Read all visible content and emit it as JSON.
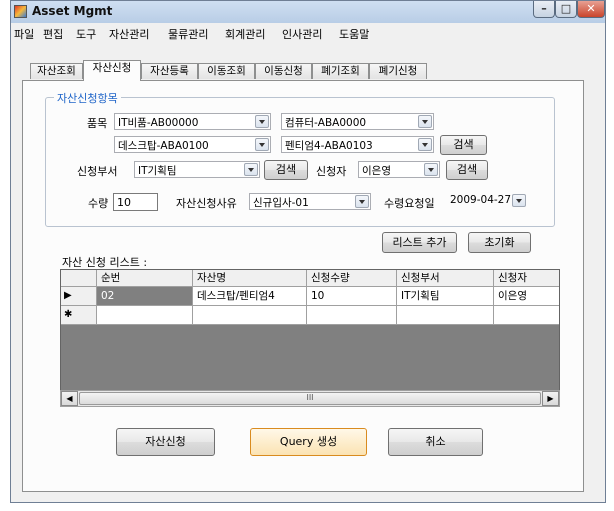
{
  "window": {
    "title": "Asset Mgmt"
  },
  "menu": [
    "파일",
    "편집",
    "도구",
    "자산관리",
    "물류관리",
    "회계관리",
    "인사관리",
    "도움말"
  ],
  "tabs": [
    "자산조회",
    "자산신청",
    "자산등록",
    "이동조회",
    "이동신청",
    "폐기조회",
    "폐기신청"
  ],
  "active_tab": "자산신청",
  "form": {
    "group_title": "자산신청항목",
    "item_label": "품목",
    "item_combo1": "IT비품-AB00000",
    "item_combo2": "컴퓨터-ABA0000",
    "item_combo3": "데스크탑-ABA0100",
    "item_combo4": "펜티엄4-ABA0103",
    "search_label": "검색",
    "dept_label": "신청부서",
    "dept_value": "IT기획팀",
    "requester_label": "신청자",
    "requester_value": "이은영",
    "qty_label": "수량",
    "qty_value": "10",
    "reason_label": "자산신청사유",
    "reason_value": "신규입사-01",
    "date_label": "수령요청일",
    "date_value": "2009-04-27",
    "add_list_button": "리스트 추가",
    "reset_button": "초기화"
  },
  "list": {
    "title": "자산 신청 리스트 :",
    "columns": [
      "순번",
      "자산명",
      "신청수량",
      "신청부서",
      "신청자"
    ],
    "rows": [
      {
        "marker": "▶",
        "cells": [
          "02",
          "데스크탑/펜티엄4",
          "10",
          "IT기획팀",
          "이은영"
        ]
      }
    ],
    "new_row_marker": "✱",
    "scroll_thumb": "III"
  },
  "buttons": {
    "apply": "자산신청",
    "query": "Query 생성",
    "cancel": "취소"
  },
  "colors": {
    "accent": "#1e64c8",
    "grid_bg": "#808080",
    "selected_cell": "#808080"
  }
}
